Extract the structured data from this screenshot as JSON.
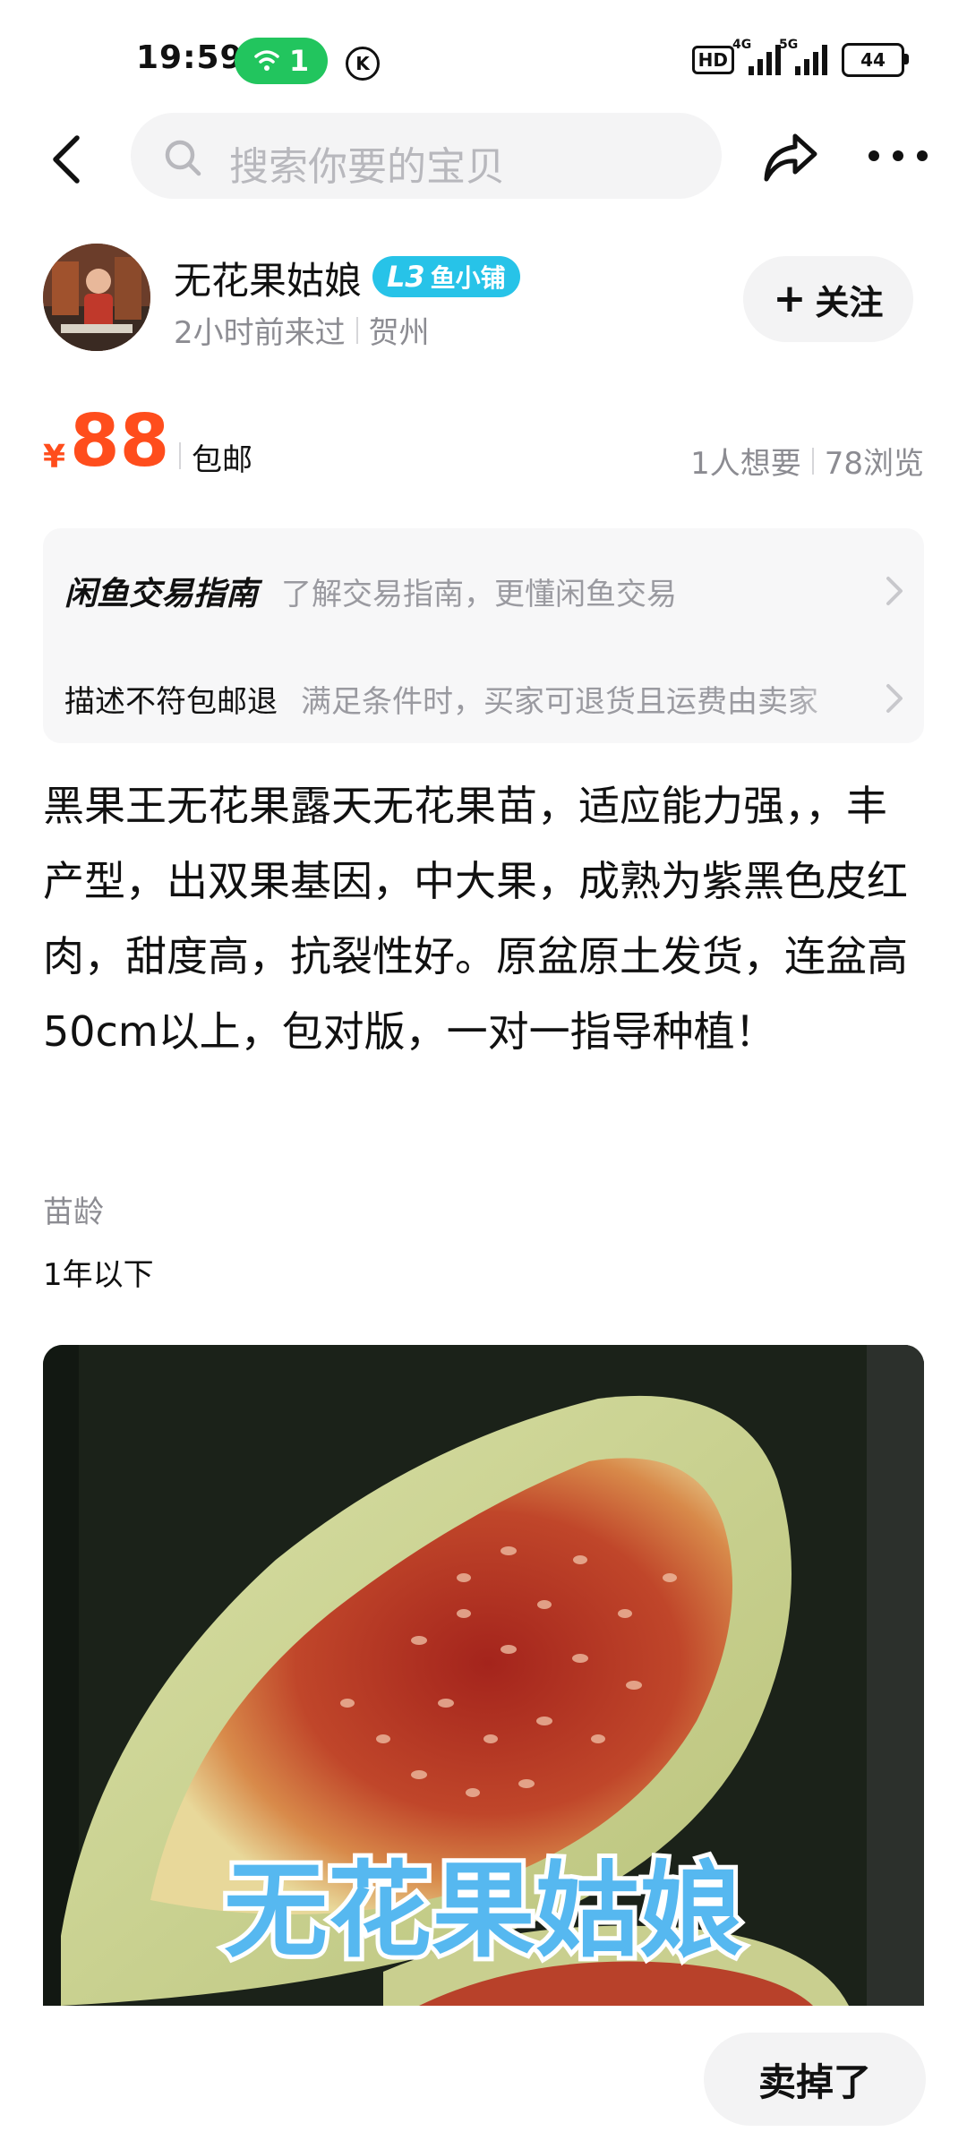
{
  "status_bar": {
    "time": "19:59",
    "wifi_count": "1",
    "k_badge": "K",
    "hd": "HD",
    "net1": "4G",
    "net2": "5G",
    "battery": "44"
  },
  "search": {
    "placeholder": "搜索你要的宝贝"
  },
  "seller": {
    "name": "无花果姑娘",
    "level_code": "L3",
    "level_label": "鱼小铺",
    "last_seen": "2小时前来过",
    "location": "贺州",
    "follow_label": "关注"
  },
  "price": {
    "currency": "¥",
    "value": "88",
    "shipping": "包邮",
    "wants": "1人想要",
    "views": "78浏览"
  },
  "guide": {
    "title_1": "闲鱼交易指南",
    "desc_1": "了解交易指南，更懂闲鱼交易",
    "title_2": "描述不符包邮退",
    "desc_2": "满足条件时，买家可退货且运费由卖家"
  },
  "description": {
    "text": "黑果王无花果露天无花果苗，适应能力强，，丰产型，出双果基因，中大果，成熟为紫黑色皮红肉，甜度高，抗裂性好。原盆原土发货，连盆高50cm以上，包对版，一对一指导种植！"
  },
  "attribute": {
    "label": "苗龄",
    "value": "1年以下"
  },
  "image": {
    "watermark": "无花果姑娘"
  },
  "bottom": {
    "sold_label": "卖掉了"
  },
  "colors": {
    "accent_price": "#ff4d1c",
    "wifi_pill": "#22c55e",
    "level_badge": "#27c3e8"
  }
}
